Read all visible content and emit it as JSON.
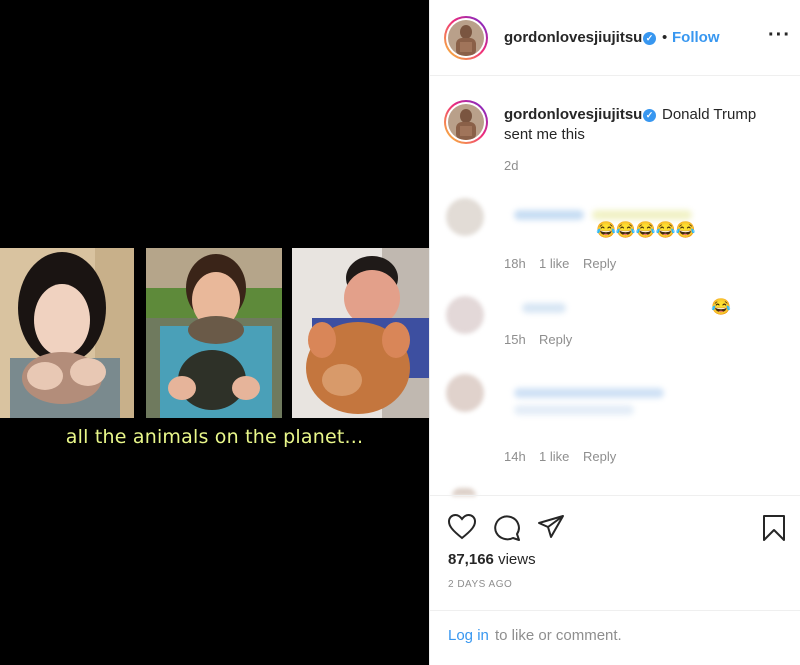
{
  "video": {
    "caption": "all the animals on the planet..."
  },
  "post": {
    "username": "gordonlovesjiujitsu",
    "follow_label": "Follow",
    "dot": "•",
    "more_icon": "more-horizontal-icon",
    "caption_line1": "Donald Trump",
    "caption_line2": "sent me this",
    "caption_time": "2d"
  },
  "comments": [
    {
      "emojis": "😂😂😂😂😂",
      "time": "18h",
      "likes": "1 like",
      "reply": "Reply"
    },
    {
      "emojis": "😂",
      "time": "15h",
      "reply": "Reply"
    },
    {
      "time": "14h",
      "likes": "1 like",
      "reply": "Reply"
    }
  ],
  "actions": {
    "views_count": "87,166",
    "views_label": "views",
    "date": "2 DAYS AGO",
    "login_link": "Log in",
    "login_rest": "to like or comment."
  },
  "colors": {
    "accent": "#3897f0",
    "caption_video": "#e9f78a",
    "muted": "#8e8e8e"
  }
}
